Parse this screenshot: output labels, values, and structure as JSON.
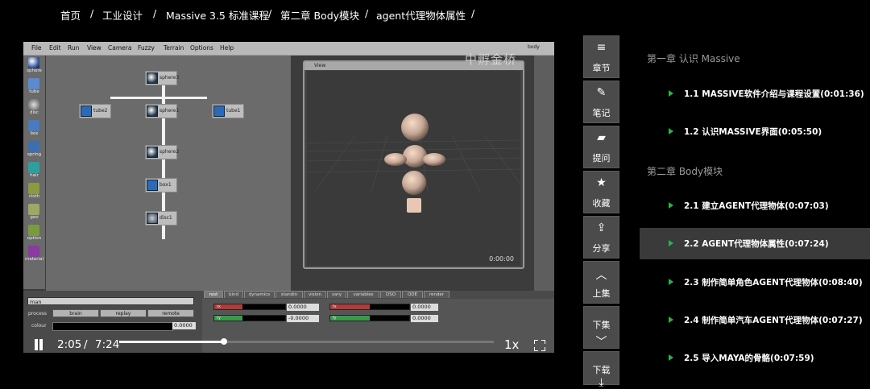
{
  "breadcrumb": [
    {
      "label": "首页"
    },
    {
      "label": "工业设计"
    },
    {
      "label": "Massive 3.5 标准课程"
    },
    {
      "label": "第二章 Body模块"
    },
    {
      "label": "agent代理物体属性"
    }
  ],
  "breadcrumb_separator": "/",
  "video": {
    "app_menu": [
      "File",
      "Edit",
      "Run",
      "View",
      "Camera",
      "Fuzzy",
      "Terrain",
      "Options",
      "Help"
    ],
    "tools": [
      "sphere",
      "tube",
      "disc",
      "box",
      "spring",
      "hair",
      "cloth",
      "geo",
      "option",
      "material"
    ],
    "nodes": {
      "sphere3": "sphere3",
      "tube2": "tube2",
      "sphere1": "sphere1",
      "tube1": "tube1",
      "sphere2": "sphere2",
      "box1": "box1",
      "disc1": "disc1"
    },
    "view_title": "View",
    "view_time": "0:00:00",
    "watermark": "中孵金桥",
    "body_tab": "body",
    "name_field": "man",
    "process_label": "process",
    "process_buttons": [
      "brain",
      "replay",
      "remote"
    ],
    "colour_label": "colour",
    "colour_value": "0.0000",
    "attr_tabs": [
      "rest",
      "bind",
      "dynamics",
      "standin",
      "vision",
      "vary",
      "variables",
      "DSO",
      "ODE",
      "render"
    ],
    "attr_rows": [
      {
        "a_label": "rx",
        "a_value": "0.0000",
        "b_label": "fx",
        "b_value": "0.0000",
        "color": "#b13a3a"
      },
      {
        "a_label": "ry",
        "a_value": "-0.0000",
        "b_label": "fy",
        "b_value": "0.0000",
        "color": "#3a9a4a"
      }
    ]
  },
  "controls": {
    "current_time": "2:05",
    "separator": "/",
    "total_time": "7:24",
    "progress": 0.28,
    "speed": "1x"
  },
  "side_buttons": [
    {
      "icon": "≡",
      "label": "章节",
      "name": "chapters-button"
    },
    {
      "icon": "✎",
      "label": "笔记",
      "name": "notes-button"
    },
    {
      "icon": "▰",
      "label": "提问",
      "name": "ask-button"
    },
    {
      "icon": "★",
      "label": "收藏",
      "name": "favorite-button"
    },
    {
      "icon": "⇪",
      "label": "分享",
      "name": "share-button"
    },
    {
      "icon": "︿",
      "label": "上集",
      "name": "prev-episode-button"
    },
    {
      "icon": "﹀",
      "label": "下集",
      "name": "next-episode-button"
    },
    {
      "icon": "⤓",
      "label": "下载",
      "name": "download-button"
    }
  ],
  "chapters": [
    {
      "title": "第一章 认识 Massive",
      "lessons": [
        {
          "label": "1.1 MASSIVE软件介绍与课程设置(0:01:36)",
          "active": false
        },
        {
          "label": "1.2 认识MASSIVE界面(0:05:50)",
          "active": false
        }
      ]
    },
    {
      "title": "第二章 Body模块",
      "lessons": [
        {
          "label": "2.1 建立AGENT代理物体(0:07:03)",
          "active": false
        },
        {
          "label": "2.2 AGENT代理物体属性(0:07:24)",
          "active": true
        },
        {
          "label": "2.3 制作简单角色AGENT代理物体(0:08:40)",
          "active": false
        },
        {
          "label": "2.4 制作简单汽车AGENT代理物体(0:07:27)",
          "active": false
        },
        {
          "label": "2.5 导入MAYA的骨骼(0:07:59)",
          "active": false
        }
      ]
    }
  ],
  "colors": {
    "accent_play": "#2fb04a",
    "active_row": "#3a3a3a",
    "side_button_bg": "#4b4b4b"
  }
}
